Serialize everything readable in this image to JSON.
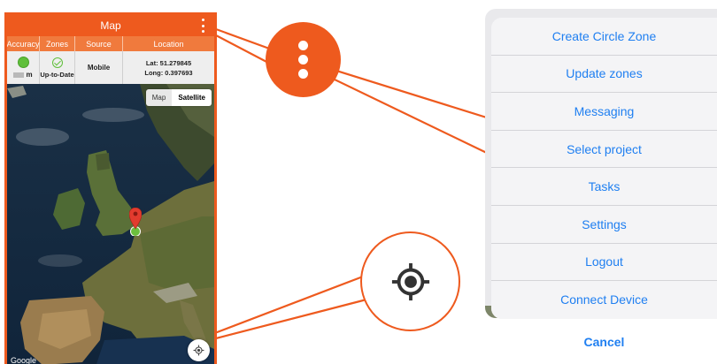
{
  "app": {
    "title": "Map",
    "menu_icon": "kebab-vertical-icon",
    "brand_color": "#ee5a1e"
  },
  "status_table": {
    "headers": [
      "Accuracy",
      "Zones",
      "Source",
      "Location"
    ],
    "accuracy": {
      "icon": "green-dot-icon",
      "unit": "m"
    },
    "zones": {
      "icon": "check-circle-icon",
      "value": "Up-to-Date"
    },
    "source": {
      "value": "Mobile"
    },
    "location": {
      "lat": "Lat: 51.279845",
      "long": "Long: 0.397693"
    }
  },
  "map": {
    "type_options": [
      "Map",
      "Satellite"
    ],
    "selected_type": "Satellite",
    "attribution": "Google",
    "marker_icon": "map-pin-icon",
    "locate_button_icon": "my-location-icon"
  },
  "callouts": {
    "menu_icon": "kebab-vertical-icon",
    "locate_icon": "my-location-icon"
  },
  "action_sheet": {
    "items": [
      "Create Circle Zone",
      "Update zones",
      "Messaging",
      "Select project",
      "Tasks",
      "Settings",
      "Logout",
      "Connect Device"
    ],
    "cancel": "Cancel",
    "accent_color": "#1f7ff1"
  }
}
